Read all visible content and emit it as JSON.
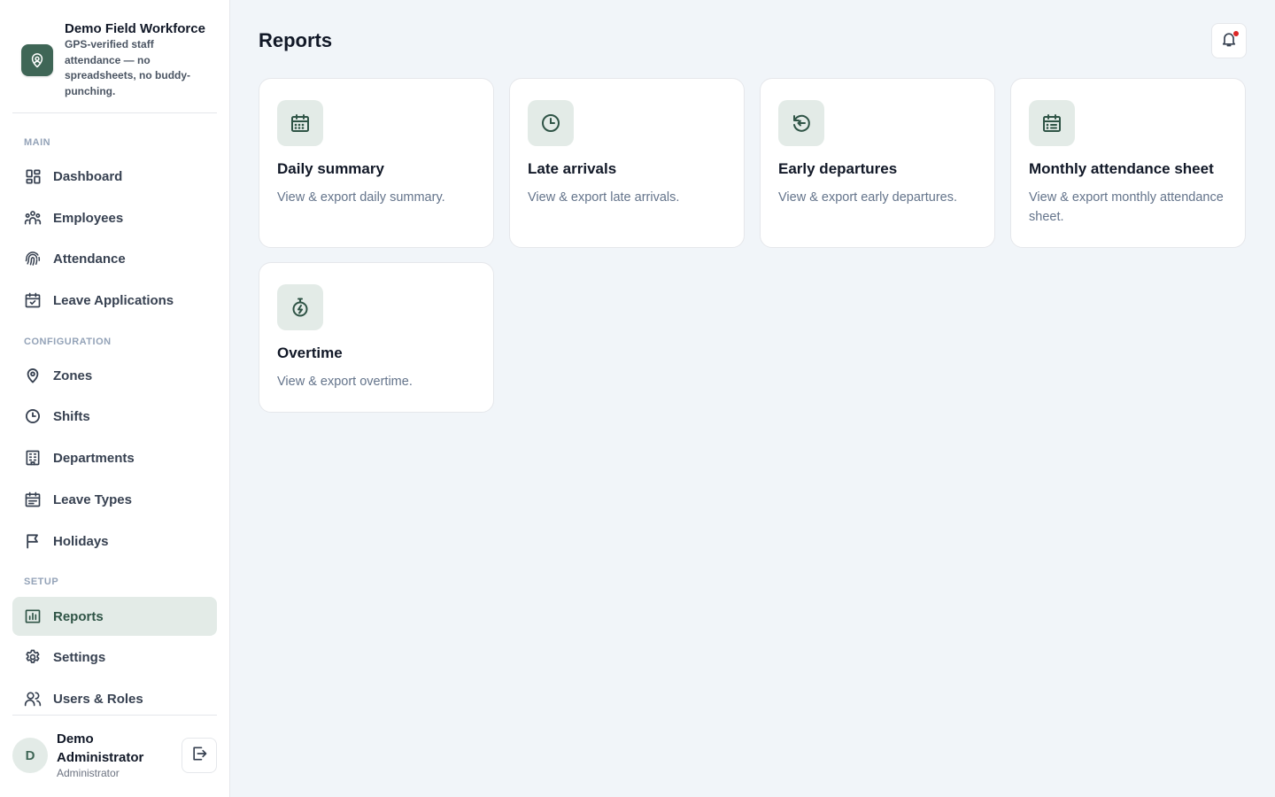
{
  "brand": {
    "title": "Demo Field Workforce",
    "subtitle": "GPS-verified staff attendance — no spreadsheets, no buddy-punching.",
    "logo_icon": "map-pin-icon",
    "accent": "#3f6656"
  },
  "sidebar": {
    "sections": {
      "main": "MAIN",
      "configuration": "CONFIGURATION",
      "setup": "SETUP"
    },
    "items": [
      {
        "label": "Dashboard",
        "icon": "dashboard-icon"
      },
      {
        "label": "Employees",
        "icon": "users-group-icon"
      },
      {
        "label": "Attendance",
        "icon": "fingerprint-icon"
      },
      {
        "label": "Leave Applications",
        "icon": "calendar-check-icon"
      },
      {
        "label": "Zones",
        "icon": "map-pin-icon"
      },
      {
        "label": "Shifts",
        "icon": "clock-icon"
      },
      {
        "label": "Departments",
        "icon": "building-icon"
      },
      {
        "label": "Leave Types",
        "icon": "calendar-list-icon"
      },
      {
        "label": "Holidays",
        "icon": "flag-icon"
      },
      {
        "label": "Reports",
        "icon": "bar-chart-icon",
        "active": true
      },
      {
        "label": "Settings",
        "icon": "gear-icon"
      },
      {
        "label": "Users & Roles",
        "icon": "user-roles-icon"
      }
    ]
  },
  "user": {
    "initial": "D",
    "name": "Demo Administrator",
    "role": "Administrator"
  },
  "header": {
    "title": "Reports"
  },
  "reports": [
    {
      "title": "Daily summary",
      "description": "View & export daily summary.",
      "icon": "calendar-icon"
    },
    {
      "title": "Late arrivals",
      "description": "View & export late arrivals.",
      "icon": "clock-icon"
    },
    {
      "title": "Early departures",
      "description": "View & export early departures.",
      "icon": "history-icon"
    },
    {
      "title": "Monthly attendance sheet",
      "description": "View & export monthly attendance sheet.",
      "icon": "calendar-list-icon"
    },
    {
      "title": "Overtime",
      "description": "View & export overtime.",
      "icon": "stopwatch-icon"
    }
  ],
  "colors": {
    "accent": "#3f6656",
    "active_bg": "#e3ebe7",
    "notification_dot": "#dc2626"
  }
}
